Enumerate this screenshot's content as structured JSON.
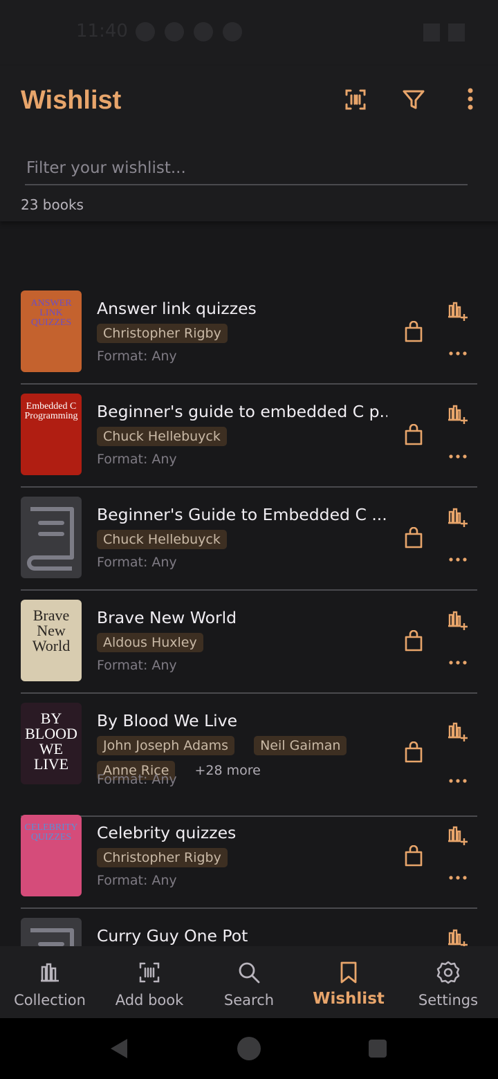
{
  "status_bar": {
    "time": "11:40"
  },
  "header": {
    "title": "Wishlist",
    "filter_placeholder": "Filter your wishlist...",
    "book_count": "23 books"
  },
  "books": [
    {
      "title": "Answer link quizzes",
      "authors": [
        "Christopher Rigby"
      ],
      "more": "",
      "format": "Format: Any",
      "cover": {
        "bg": "#c4622e",
        "text": "ANSWER LINK QUIZZES",
        "color": "#6b4fc4"
      }
    },
    {
      "title": "Beginner's guide to embedded C p...",
      "authors": [
        "Chuck Hellebuyck"
      ],
      "more": "",
      "format": "Format: Any",
      "cover": {
        "bg": "#b01e12",
        "text": "Embedded C Programming",
        "color": "#ffffff"
      }
    },
    {
      "title": "Beginner's Guide to Embedded C ...",
      "authors": [
        "Chuck Hellebuyck"
      ],
      "more": "",
      "format": "Format: Any",
      "cover": {
        "bg": "#3a3a3e",
        "text": "",
        "color": "#7c7c86"
      }
    },
    {
      "title": "Brave New World",
      "authors": [
        "Aldous Huxley"
      ],
      "more": "",
      "format": "Format: Any",
      "cover": {
        "bg": "#d8ccb0",
        "text": "Brave New World",
        "color": "#2a2622"
      }
    },
    {
      "title": "By Blood We Live",
      "authors": [
        "John Joseph Adams",
        "Neil Gaiman",
        "Anne Rice"
      ],
      "more": "+28 more",
      "format": "Format: Any",
      "cover": {
        "bg": "#2a1a24",
        "text": "BY BLOOD WE LIVE",
        "color": "#ffffff"
      }
    },
    {
      "title": "Celebrity quizzes",
      "authors": [
        "Christopher Rigby"
      ],
      "more": "",
      "format": "Format: Any",
      "cover": {
        "bg": "#d54c7a",
        "text": "CELEBRITY QUIZZES",
        "color": "#5a8fd6"
      }
    },
    {
      "title": "Curry Guy One Pot",
      "authors": [],
      "more": "",
      "format": "",
      "cover": {
        "bg": "#3a3a3e",
        "text": "",
        "color": "#7c7c86"
      }
    }
  ],
  "bottom_nav": [
    {
      "label": "Collection",
      "icon": "collection-icon",
      "active": false
    },
    {
      "label": "Add book",
      "icon": "barcode-scan-icon",
      "active": false
    },
    {
      "label": "Search",
      "icon": "search-icon",
      "active": false
    },
    {
      "label": "Wishlist",
      "icon": "bookmark-icon",
      "active": true
    },
    {
      "label": "Settings",
      "icon": "gear-icon",
      "active": false
    }
  ],
  "colors": {
    "accent": "#e8a56b",
    "background": "#18181a",
    "chip": "#3d2f22"
  }
}
